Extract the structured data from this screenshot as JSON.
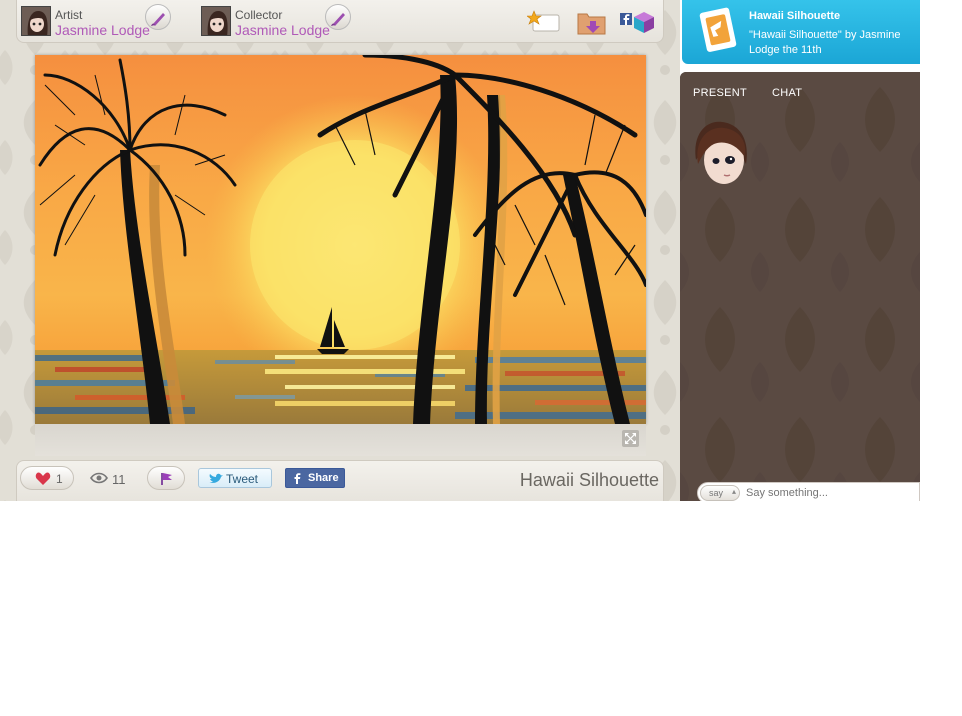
{
  "header": {
    "artist_role": "Artist",
    "artist_name": "Jasmine Lodge",
    "collector_role": "Collector",
    "collector_name": "Jasmine Lodge",
    "icons": [
      "brush-icon",
      "favorite-icon",
      "download-folder-icon",
      "facebook-icon",
      "gift-cube-icon"
    ]
  },
  "artwork": {
    "title": "Hawaii Silhouette"
  },
  "actions": {
    "like_count": "1",
    "view_count": "11",
    "tweet_label": "Tweet",
    "share_label": "Share"
  },
  "notification": {
    "title": "Hawaii Silhouette",
    "text": "\"Hawaii Silhouette\" by Jasmine Lodge the 11th"
  },
  "panel": {
    "tabs": [
      "PRESENT",
      "CHAT"
    ]
  },
  "chat": {
    "mode_label": "say",
    "placeholder": "Say something..."
  },
  "colors": {
    "accent": "#b05ab8",
    "notification_bg": "#1ba6d6",
    "panel_bg": "#5a4a42",
    "facebook": "#3b5998",
    "like_heart": "#d9364a"
  }
}
